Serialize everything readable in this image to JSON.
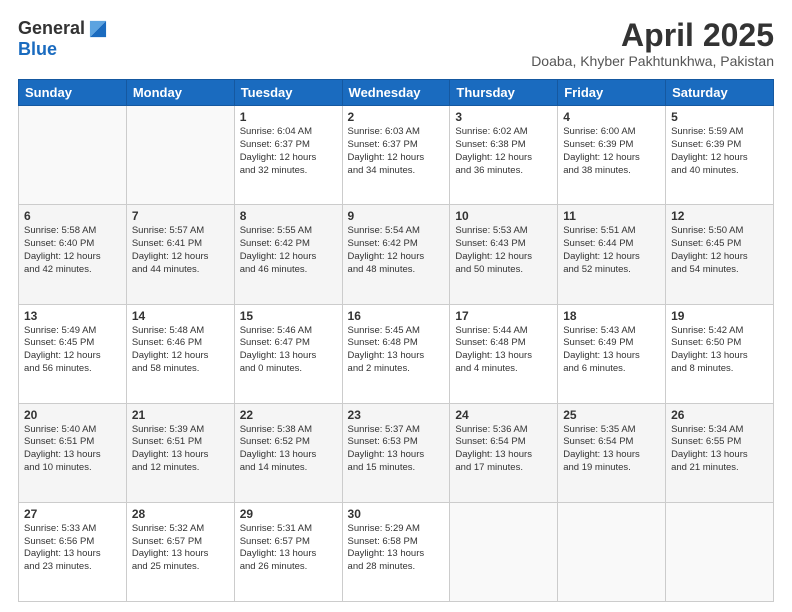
{
  "logo": {
    "general": "General",
    "blue": "Blue"
  },
  "title": "April 2025",
  "subtitle": "Doaba, Khyber Pakhtunkhwa, Pakistan",
  "headers": [
    "Sunday",
    "Monday",
    "Tuesday",
    "Wednesday",
    "Thursday",
    "Friday",
    "Saturday"
  ],
  "weeks": [
    [
      {
        "day": "",
        "info": ""
      },
      {
        "day": "",
        "info": ""
      },
      {
        "day": "1",
        "info": "Sunrise: 6:04 AM\nSunset: 6:37 PM\nDaylight: 12 hours\nand 32 minutes."
      },
      {
        "day": "2",
        "info": "Sunrise: 6:03 AM\nSunset: 6:37 PM\nDaylight: 12 hours\nand 34 minutes."
      },
      {
        "day": "3",
        "info": "Sunrise: 6:02 AM\nSunset: 6:38 PM\nDaylight: 12 hours\nand 36 minutes."
      },
      {
        "day": "4",
        "info": "Sunrise: 6:00 AM\nSunset: 6:39 PM\nDaylight: 12 hours\nand 38 minutes."
      },
      {
        "day": "5",
        "info": "Sunrise: 5:59 AM\nSunset: 6:39 PM\nDaylight: 12 hours\nand 40 minutes."
      }
    ],
    [
      {
        "day": "6",
        "info": "Sunrise: 5:58 AM\nSunset: 6:40 PM\nDaylight: 12 hours\nand 42 minutes."
      },
      {
        "day": "7",
        "info": "Sunrise: 5:57 AM\nSunset: 6:41 PM\nDaylight: 12 hours\nand 44 minutes."
      },
      {
        "day": "8",
        "info": "Sunrise: 5:55 AM\nSunset: 6:42 PM\nDaylight: 12 hours\nand 46 minutes."
      },
      {
        "day": "9",
        "info": "Sunrise: 5:54 AM\nSunset: 6:42 PM\nDaylight: 12 hours\nand 48 minutes."
      },
      {
        "day": "10",
        "info": "Sunrise: 5:53 AM\nSunset: 6:43 PM\nDaylight: 12 hours\nand 50 minutes."
      },
      {
        "day": "11",
        "info": "Sunrise: 5:51 AM\nSunset: 6:44 PM\nDaylight: 12 hours\nand 52 minutes."
      },
      {
        "day": "12",
        "info": "Sunrise: 5:50 AM\nSunset: 6:45 PM\nDaylight: 12 hours\nand 54 minutes."
      }
    ],
    [
      {
        "day": "13",
        "info": "Sunrise: 5:49 AM\nSunset: 6:45 PM\nDaylight: 12 hours\nand 56 minutes."
      },
      {
        "day": "14",
        "info": "Sunrise: 5:48 AM\nSunset: 6:46 PM\nDaylight: 12 hours\nand 58 minutes."
      },
      {
        "day": "15",
        "info": "Sunrise: 5:46 AM\nSunset: 6:47 PM\nDaylight: 13 hours\nand 0 minutes."
      },
      {
        "day": "16",
        "info": "Sunrise: 5:45 AM\nSunset: 6:48 PM\nDaylight: 13 hours\nand 2 minutes."
      },
      {
        "day": "17",
        "info": "Sunrise: 5:44 AM\nSunset: 6:48 PM\nDaylight: 13 hours\nand 4 minutes."
      },
      {
        "day": "18",
        "info": "Sunrise: 5:43 AM\nSunset: 6:49 PM\nDaylight: 13 hours\nand 6 minutes."
      },
      {
        "day": "19",
        "info": "Sunrise: 5:42 AM\nSunset: 6:50 PM\nDaylight: 13 hours\nand 8 minutes."
      }
    ],
    [
      {
        "day": "20",
        "info": "Sunrise: 5:40 AM\nSunset: 6:51 PM\nDaylight: 13 hours\nand 10 minutes."
      },
      {
        "day": "21",
        "info": "Sunrise: 5:39 AM\nSunset: 6:51 PM\nDaylight: 13 hours\nand 12 minutes."
      },
      {
        "day": "22",
        "info": "Sunrise: 5:38 AM\nSunset: 6:52 PM\nDaylight: 13 hours\nand 14 minutes."
      },
      {
        "day": "23",
        "info": "Sunrise: 5:37 AM\nSunset: 6:53 PM\nDaylight: 13 hours\nand 15 minutes."
      },
      {
        "day": "24",
        "info": "Sunrise: 5:36 AM\nSunset: 6:54 PM\nDaylight: 13 hours\nand 17 minutes."
      },
      {
        "day": "25",
        "info": "Sunrise: 5:35 AM\nSunset: 6:54 PM\nDaylight: 13 hours\nand 19 minutes."
      },
      {
        "day": "26",
        "info": "Sunrise: 5:34 AM\nSunset: 6:55 PM\nDaylight: 13 hours\nand 21 minutes."
      }
    ],
    [
      {
        "day": "27",
        "info": "Sunrise: 5:33 AM\nSunset: 6:56 PM\nDaylight: 13 hours\nand 23 minutes."
      },
      {
        "day": "28",
        "info": "Sunrise: 5:32 AM\nSunset: 6:57 PM\nDaylight: 13 hours\nand 25 minutes."
      },
      {
        "day": "29",
        "info": "Sunrise: 5:31 AM\nSunset: 6:57 PM\nDaylight: 13 hours\nand 26 minutes."
      },
      {
        "day": "30",
        "info": "Sunrise: 5:29 AM\nSunset: 6:58 PM\nDaylight: 13 hours\nand 28 minutes."
      },
      {
        "day": "",
        "info": ""
      },
      {
        "day": "",
        "info": ""
      },
      {
        "day": "",
        "info": ""
      }
    ]
  ]
}
